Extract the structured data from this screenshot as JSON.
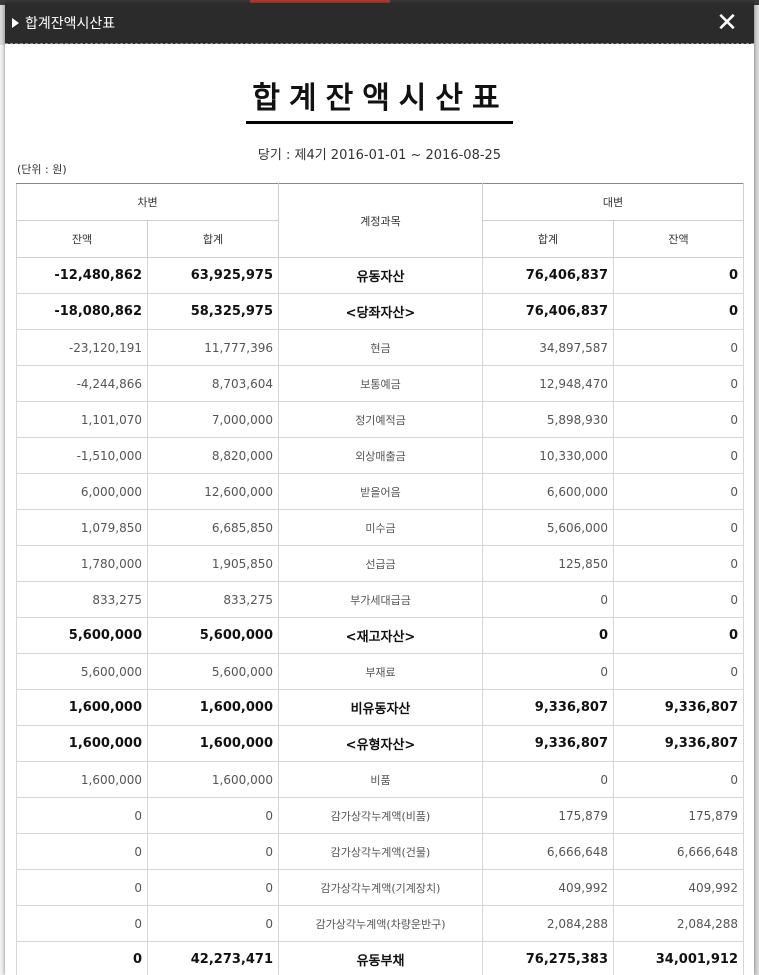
{
  "window": {
    "title": "합계잔액시산표"
  },
  "report": {
    "title": "합계잔액시산표",
    "period": "당기 : 제4기 2016-01-01 ~ 2016-08-25",
    "unit": "(단위 : 원)"
  },
  "table": {
    "debit_header": "차변",
    "credit_header": "대변",
    "account_header": "계정과목",
    "debit_balance_header": "잔액",
    "debit_total_header": "합계",
    "credit_total_header": "합계",
    "credit_balance_header": "잔액",
    "rows": [
      {
        "debit_balance": "-12,480,862",
        "debit_total": "63,925,975",
        "account": "유동자산",
        "credit_total": "76,406,837",
        "credit_balance": "0",
        "bold": true
      },
      {
        "debit_balance": "-18,080,862",
        "debit_total": "58,325,975",
        "account": "<당좌자산>",
        "credit_total": "76,406,837",
        "credit_balance": "0",
        "bold": true
      },
      {
        "debit_balance": "-23,120,191",
        "debit_total": "11,777,396",
        "account": "현금",
        "credit_total": "34,897,587",
        "credit_balance": "0",
        "bold": false
      },
      {
        "debit_balance": "-4,244,866",
        "debit_total": "8,703,604",
        "account": "보통예금",
        "credit_total": "12,948,470",
        "credit_balance": "0",
        "bold": false
      },
      {
        "debit_balance": "1,101,070",
        "debit_total": "7,000,000",
        "account": "정기예적금",
        "credit_total": "5,898,930",
        "credit_balance": "0",
        "bold": false
      },
      {
        "debit_balance": "-1,510,000",
        "debit_total": "8,820,000",
        "account": "외상매출금",
        "credit_total": "10,330,000",
        "credit_balance": "0",
        "bold": false
      },
      {
        "debit_balance": "6,000,000",
        "debit_total": "12,600,000",
        "account": "받을어음",
        "credit_total": "6,600,000",
        "credit_balance": "0",
        "bold": false
      },
      {
        "debit_balance": "1,079,850",
        "debit_total": "6,685,850",
        "account": "미수금",
        "credit_total": "5,606,000",
        "credit_balance": "0",
        "bold": false
      },
      {
        "debit_balance": "1,780,000",
        "debit_total": "1,905,850",
        "account": "선급금",
        "credit_total": "125,850",
        "credit_balance": "0",
        "bold": false
      },
      {
        "debit_balance": "833,275",
        "debit_total": "833,275",
        "account": "부가세대급금",
        "credit_total": "0",
        "credit_balance": "0",
        "bold": false
      },
      {
        "debit_balance": "5,600,000",
        "debit_total": "5,600,000",
        "account": "<재고자산>",
        "credit_total": "0",
        "credit_balance": "0",
        "bold": true
      },
      {
        "debit_balance": "5,600,000",
        "debit_total": "5,600,000",
        "account": "부재료",
        "credit_total": "0",
        "credit_balance": "0",
        "bold": false
      },
      {
        "debit_balance": "1,600,000",
        "debit_total": "1,600,000",
        "account": "비유동자산",
        "credit_total": "9,336,807",
        "credit_balance": "9,336,807",
        "bold": true
      },
      {
        "debit_balance": "1,600,000",
        "debit_total": "1,600,000",
        "account": "<유형자산>",
        "credit_total": "9,336,807",
        "credit_balance": "9,336,807",
        "bold": true
      },
      {
        "debit_balance": "1,600,000",
        "debit_total": "1,600,000",
        "account": "비품",
        "credit_total": "0",
        "credit_balance": "0",
        "bold": false
      },
      {
        "debit_balance": "0",
        "debit_total": "0",
        "account": "감가상각누계액(비품)",
        "credit_total": "175,879",
        "credit_balance": "175,879",
        "bold": false
      },
      {
        "debit_balance": "0",
        "debit_total": "0",
        "account": "감가상각누계액(건물)",
        "credit_total": "6,666,648",
        "credit_balance": "6,666,648",
        "bold": false
      },
      {
        "debit_balance": "0",
        "debit_total": "0",
        "account": "감가상각누계액(기계장치)",
        "credit_total": "409,992",
        "credit_balance": "409,992",
        "bold": false
      },
      {
        "debit_balance": "0",
        "debit_total": "0",
        "account": "감가상각누계액(차량운반구)",
        "credit_total": "2,084,288",
        "credit_balance": "2,084,288",
        "bold": false
      },
      {
        "debit_balance": "0",
        "debit_total": "42,273,471",
        "account": "유동부채",
        "credit_total": "76,275,383",
        "credit_balance": "34,001,912",
        "bold": true
      },
      {
        "debit_balance": "",
        "debit_total": "",
        "account": "",
        "credit_total": "",
        "credit_balance": "",
        "bold": false
      }
    ]
  }
}
